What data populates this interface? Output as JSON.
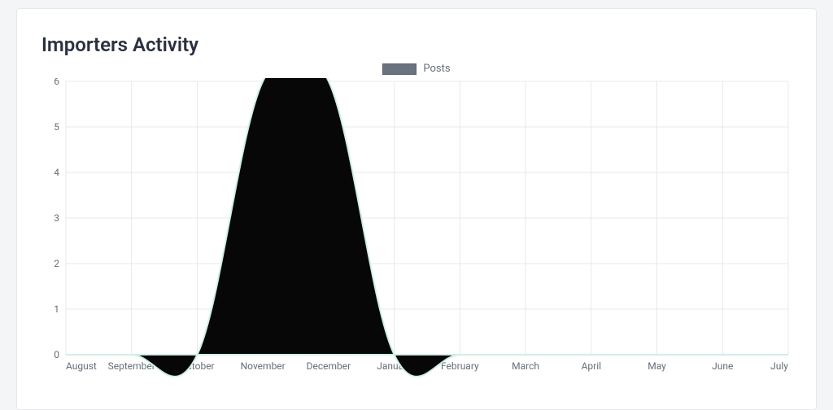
{
  "card": {
    "title": "Importers Activity"
  },
  "legend": {
    "label": "Posts"
  },
  "chart_data": {
    "type": "area",
    "title": "Importers Activity",
    "xlabel": "",
    "ylabel": "",
    "ylim": [
      0,
      6
    ],
    "yticks": [
      0,
      1,
      2,
      3,
      4,
      5,
      6
    ],
    "categories": [
      "August",
      "September",
      "October",
      "November",
      "December",
      "January",
      "February",
      "March",
      "April",
      "May",
      "June",
      "July"
    ],
    "series": [
      {
        "name": "Posts",
        "values": [
          0,
          0,
          0,
          6,
          6,
          0,
          0,
          0,
          0,
          0,
          0,
          0
        ]
      }
    ],
    "legend_position": "top",
    "grid": true
  }
}
